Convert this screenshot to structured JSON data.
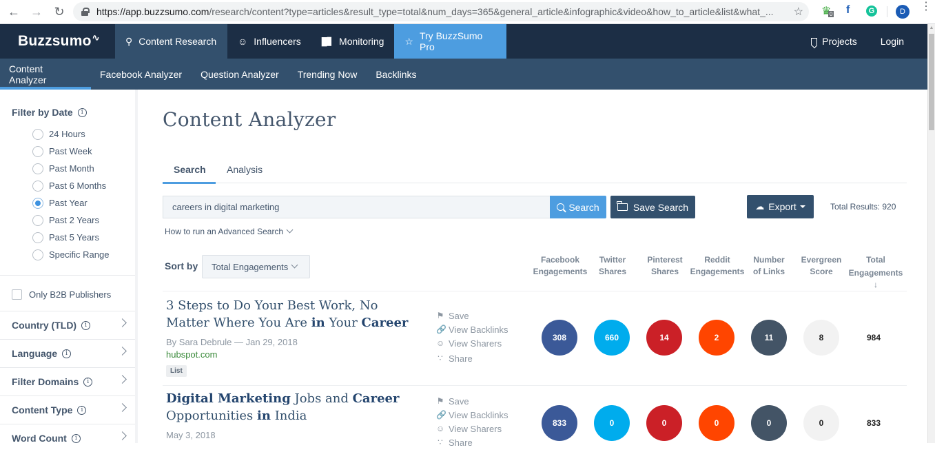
{
  "browser": {
    "url_host": "https://app.buzzsumo.com",
    "url_path": "/research/content?type=articles&result_type=total&num_days=365&general_article&infographic&video&how_to_article&list&what_...",
    "extension_badge": "0",
    "profile_initial": "D"
  },
  "topnav": {
    "logo": "Buzzsumo",
    "items": [
      {
        "label": "Content Research",
        "icon": "search-icon"
      },
      {
        "label": "Influencers",
        "icon": "user-icon"
      },
      {
        "label": "Monitoring",
        "icon": "bar-chart-icon"
      },
      {
        "label": "Try BuzzSumo Pro",
        "icon": "star-icon"
      }
    ],
    "right": [
      {
        "label": "Projects",
        "icon": "bookmark-icon"
      },
      {
        "label": "Login"
      }
    ]
  },
  "subnav": {
    "items": [
      "Content Analyzer",
      "Facebook Analyzer",
      "Question Analyzer",
      "Trending Now",
      "Backlinks"
    ]
  },
  "sidebar": {
    "filter_by_date": "Filter by Date",
    "date_options": [
      "24 Hours",
      "Past Week",
      "Past Month",
      "Past 6 Months",
      "Past Year",
      "Past 2 Years",
      "Past 5 Years",
      "Specific Range"
    ],
    "selected_date": "Past Year",
    "b2b_label": "Only B2B Publishers",
    "sections": [
      "Country (TLD)",
      "Language",
      "Filter Domains",
      "Content Type",
      "Word Count"
    ]
  },
  "main": {
    "title": "Content Analyzer",
    "tabs": [
      "Search",
      "Analysis"
    ],
    "search_value": "careers in digital marketing",
    "search_button": "Search",
    "save_search_button": "Save Search",
    "export_button": "Export",
    "total_results": "Total Results: 920",
    "advanced_search": "How to run an Advanced Search",
    "sort_by_label": "Sort by",
    "sort_by_value": "Total Engagements",
    "columns": [
      [
        "Facebook",
        "Engagements"
      ],
      [
        "Twitter",
        "Shares"
      ],
      [
        "Pinterest",
        "Shares"
      ],
      [
        "Reddit",
        "Engagements"
      ],
      [
        "Number",
        "of Links"
      ],
      [
        "Evergreen",
        "Score"
      ],
      [
        "Total",
        "Engagements ↓"
      ]
    ],
    "actions": [
      "Save",
      "View Backlinks",
      "View Sharers",
      "Share"
    ],
    "metric_colors": {
      "facebook": "#3b5998",
      "twitter": "#00aced",
      "pinterest": "#cb2027",
      "reddit": "#ff4500",
      "links": "#435466",
      "evergreen": "#f2f2f2"
    },
    "results": [
      {
        "title_parts": [
          {
            "t": "3 Steps to Do Your Best Work, No Matter Where You Are ",
            "b": false
          },
          {
            "t": "in",
            "b": true
          },
          {
            "t": " Your ",
            "b": false
          },
          {
            "t": "Career",
            "b": true
          }
        ],
        "author": "By Sara Debrule",
        "date": "Jan 29, 2018",
        "domain": "hubspot.com",
        "tag": "List",
        "facebook": "308",
        "twitter": "660",
        "pinterest": "14",
        "reddit": "2",
        "links": "11",
        "evergreen": "8",
        "total": "984"
      },
      {
        "title_parts": [
          {
            "t": "Digital Marketing",
            "b": true
          },
          {
            "t": " Jobs and ",
            "b": false
          },
          {
            "t": "Career",
            "b": true
          },
          {
            "t": " Opportunities ",
            "b": false
          },
          {
            "t": "in",
            "b": true
          },
          {
            "t": " India",
            "b": false
          }
        ],
        "author": "",
        "date": "May 3, 2018",
        "domain": "",
        "tag": "",
        "facebook": "833",
        "twitter": "0",
        "pinterest": "0",
        "reddit": "0",
        "links": "0",
        "evergreen": "0",
        "total": "833"
      }
    ]
  }
}
